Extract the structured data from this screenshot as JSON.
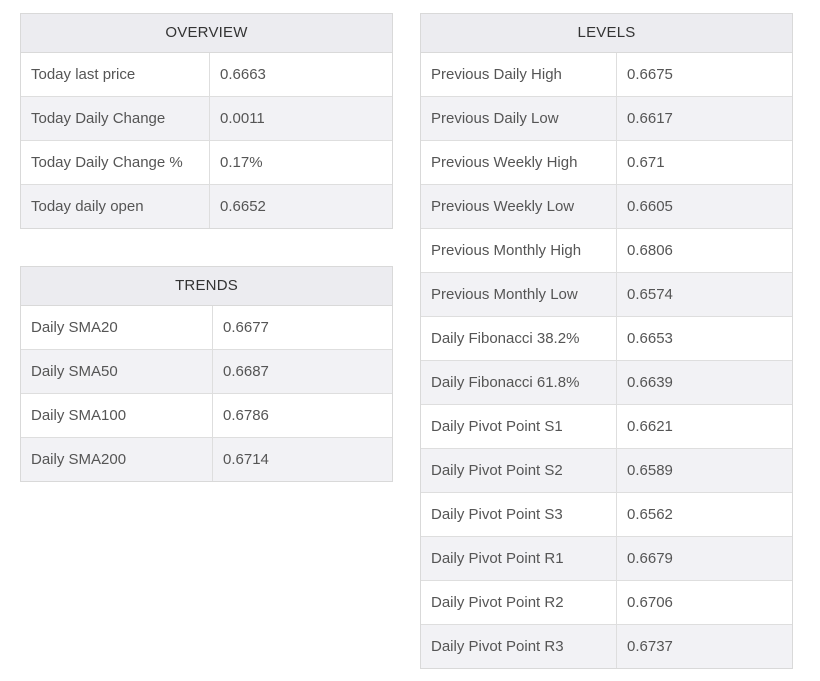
{
  "overview": {
    "title": "OVERVIEW",
    "rows": [
      {
        "label": "Today last price",
        "value": "0.6663"
      },
      {
        "label": "Today Daily Change",
        "value": "0.0011"
      },
      {
        "label": "Today Daily Change %",
        "value": "0.17%"
      },
      {
        "label": "Today daily open",
        "value": "0.6652"
      }
    ]
  },
  "trends": {
    "title": "TRENDS",
    "rows": [
      {
        "label": "Daily SMA20",
        "value": "0.6677"
      },
      {
        "label": "Daily SMA50",
        "value": "0.6687"
      },
      {
        "label": "Daily SMA100",
        "value": "0.6786"
      },
      {
        "label": "Daily SMA200",
        "value": "0.6714"
      }
    ]
  },
  "levels": {
    "title": "LEVELS",
    "rows": [
      {
        "label": "Previous Daily High",
        "value": "0.6675"
      },
      {
        "label": "Previous Daily Low",
        "value": "0.6617"
      },
      {
        "label": "Previous Weekly High",
        "value": "0.671"
      },
      {
        "label": "Previous Weekly Low",
        "value": "0.6605"
      },
      {
        "label": "Previous Monthly High",
        "value": "0.6806"
      },
      {
        "label": "Previous Monthly Low",
        "value": "0.6574"
      },
      {
        "label": "Daily Fibonacci 38.2%",
        "value": "0.6653"
      },
      {
        "label": "Daily Fibonacci 61.8%",
        "value": "0.6639"
      },
      {
        "label": "Daily Pivot Point S1",
        "value": "0.6621"
      },
      {
        "label": "Daily Pivot Point S2",
        "value": "0.6589"
      },
      {
        "label": "Daily Pivot Point S3",
        "value": "0.6562"
      },
      {
        "label": "Daily Pivot Point R1",
        "value": "0.6679"
      },
      {
        "label": "Daily Pivot Point R2",
        "value": "0.6706"
      },
      {
        "label": "Daily Pivot Point R3",
        "value": "0.6737"
      }
    ]
  },
  "colors": {
    "header_bg": "#ececf0",
    "alt_row_bg": "#f2f2f5",
    "border": "#d9d9d9",
    "text": "#555555"
  }
}
